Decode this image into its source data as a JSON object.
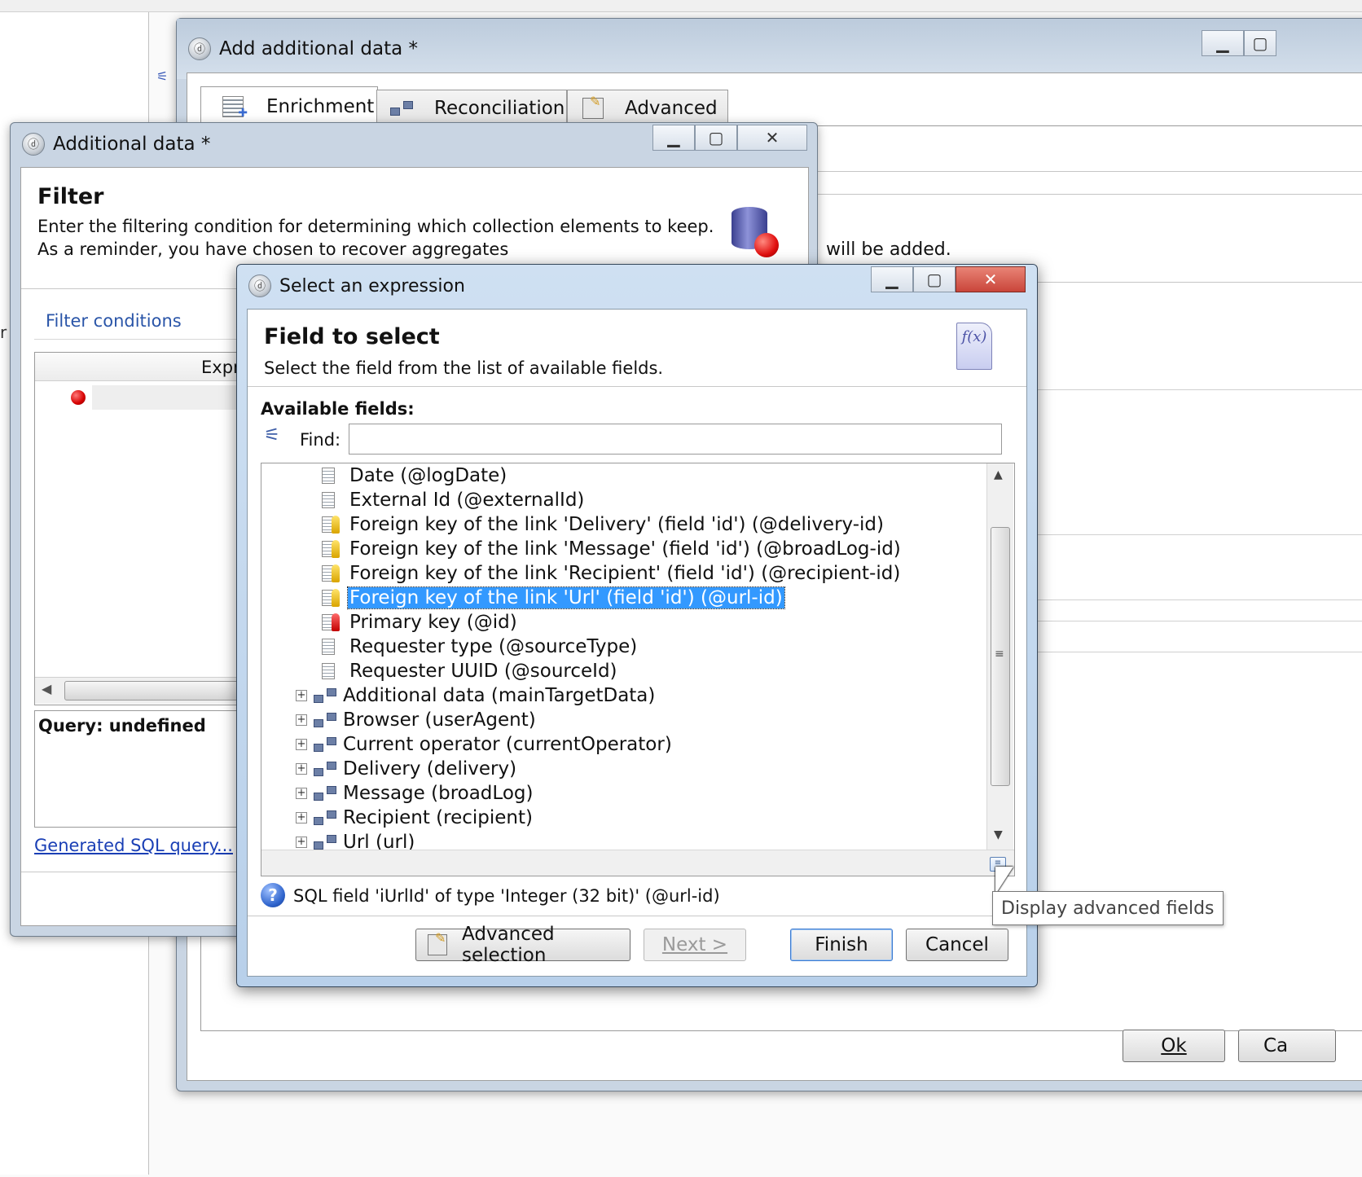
{
  "add_dialog": {
    "title": "Add additional data *",
    "tabs": [
      "Enrichment",
      "Reconciliation",
      "Advanced"
    ],
    "partial_text": "will be added.",
    "ok_label": "Ok",
    "cancel_partial": "Ca"
  },
  "additional_dialog": {
    "title": "Additional data *",
    "heading": "Filter",
    "desc1": "Enter the filtering condition for determining which collection elements to keep.",
    "desc2": "As a reminder, you have chosen to recover aggregates",
    "filter_conditions": "Filter conditions",
    "grid_header": "Expr",
    "query_label": "Query: undefined",
    "sql_link": "Generated SQL query..."
  },
  "select_dialog": {
    "title": "Select an expression",
    "heading": "Field to select",
    "desc": "Select the field from the list of available fields.",
    "available_label": "Available fields:",
    "find_label": "Find:",
    "find_value": "",
    "fields": [
      {
        "label": "Date (@logDate)",
        "type": "field"
      },
      {
        "label": "External Id (@externalId)",
        "type": "field"
      },
      {
        "label": "Foreign key of the link 'Delivery' (field 'id') (@delivery-id)",
        "type": "fkey"
      },
      {
        "label": "Foreign key of the link 'Message' (field 'id') (@broadLog-id)",
        "type": "fkey"
      },
      {
        "label": "Foreign key of the link 'Recipient' (field 'id') (@recipient-id)",
        "type": "fkey"
      },
      {
        "label": "Foreign key of the link 'Url' (field 'id') (@url-id)",
        "type": "fkey",
        "selected": true
      },
      {
        "label": "Primary key (@id)",
        "type": "pkey"
      },
      {
        "label": "Requester type (@sourceType)",
        "type": "field"
      },
      {
        "label": "Requester UUID (@sourceId)",
        "type": "field"
      },
      {
        "label": "Additional data (mainTargetData)",
        "type": "link"
      },
      {
        "label": "Browser (userAgent)",
        "type": "link"
      },
      {
        "label": "Current operator (currentOperator)",
        "type": "link"
      },
      {
        "label": "Delivery (delivery)",
        "type": "link"
      },
      {
        "label": "Message (broadLog)",
        "type": "link"
      },
      {
        "label": "Recipient (recipient)",
        "type": "link"
      },
      {
        "label": "Url (url)",
        "type": "link"
      }
    ],
    "info_text": "SQL field 'iUrlId' of type 'Integer (32 bit)' (@url-id)",
    "tooltip": "Display advanced fields",
    "buttons": {
      "advanced": "Advanced selection",
      "next": "Next >",
      "finish": "Finish",
      "cancel": "Cancel"
    }
  },
  "colors": {
    "selection": "#3399ff",
    "link": "#1a3fb5",
    "close_red": "#c9453a"
  }
}
